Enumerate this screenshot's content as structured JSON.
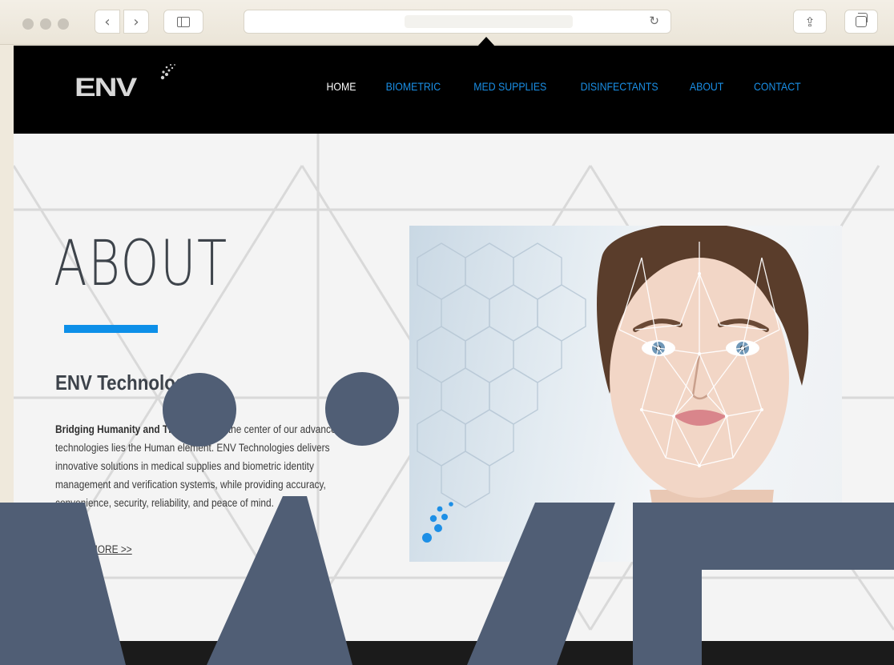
{
  "browser": {
    "back_glyph": "‹",
    "forward_glyph": "›",
    "reload_glyph": "↻",
    "share_glyph": "⇪",
    "icons": [
      "back-icon",
      "forward-icon",
      "sidebar-icon",
      "reload-icon",
      "share-icon",
      "tabs-icon"
    ]
  },
  "site": {
    "logo_text": "ENV",
    "nav": [
      {
        "label": "HOME",
        "active": true
      },
      {
        "label": "BIOMETRIC",
        "active": false
      },
      {
        "label": "MED SUPPLIES",
        "active": false
      },
      {
        "label": "DISINFECTANTS",
        "active": false
      },
      {
        "label": "ABOUT",
        "active": false
      },
      {
        "label": "CONTACT",
        "active": false
      }
    ],
    "colors": {
      "accent": "#0d8fe8",
      "header_bg": "#000000",
      "overlay": "#505e75"
    }
  },
  "about": {
    "title": "ABOUT",
    "company": "ENV Technologies",
    "lead": "Bridging Humanity and The Future.",
    "body": " At the center of our advanced technologies lies the Human element. ENV Technologies delivers innovative solutions in medical supplies and biometric identity management and verification systems, while providing accuracy, convenience, security, reliability, and peace of mind.",
    "learn_more": "LEARN MORE >>"
  }
}
